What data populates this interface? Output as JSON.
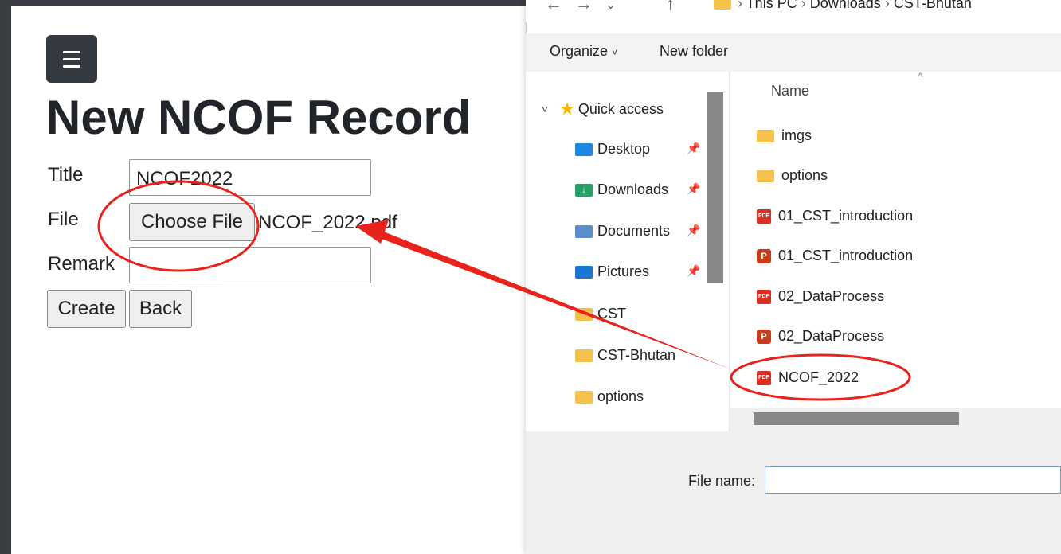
{
  "web": {
    "title": "New NCOF Record",
    "form": {
      "title_label": "Title",
      "title_value": "NCOF2022",
      "file_label": "File",
      "choose_file_label": "Choose File",
      "file_name": "NCOF_2022.pdf",
      "remark_label": "Remark",
      "remark_value": "",
      "create_label": "Create",
      "back_label": "Back"
    }
  },
  "dialog": {
    "breadcrumb": [
      "This PC",
      "Downloads",
      "CST-Bhutan"
    ],
    "toolbar": {
      "organize": "Organize",
      "new_folder": "New folder"
    },
    "nav": {
      "quick_access": "Quick access",
      "items": [
        "Desktop",
        "Downloads",
        "Documents",
        "Pictures",
        "CST",
        "CST-Bhutan",
        "options"
      ]
    },
    "column_name": "Name",
    "files": [
      {
        "name": "imgs",
        "type": "folder"
      },
      {
        "name": "options",
        "type": "folder"
      },
      {
        "name": "01_CST_introduction",
        "type": "pdf"
      },
      {
        "name": "01_CST_introduction",
        "type": "ppt"
      },
      {
        "name": "02_DataProcess",
        "type": "pdf"
      },
      {
        "name": "02_DataProcess",
        "type": "ppt"
      },
      {
        "name": "NCOF_2022",
        "type": "pdf"
      }
    ],
    "file_name_label": "File name:",
    "file_name_value": ""
  },
  "colors": {
    "annotation": "#e8231b",
    "folder": "#f4c24d",
    "pdf": "#d93025"
  }
}
